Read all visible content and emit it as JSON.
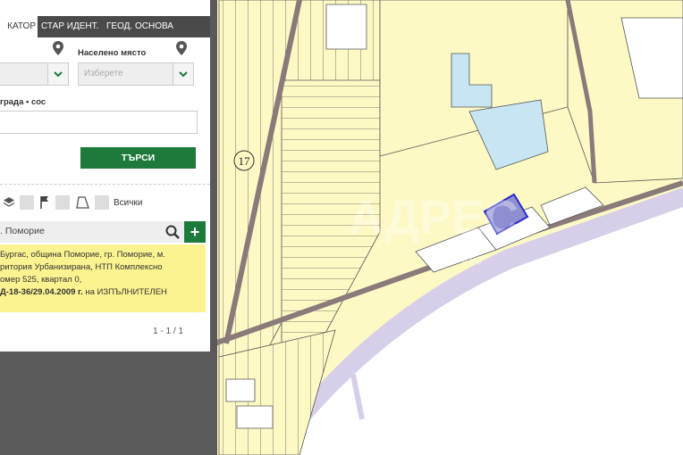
{
  "tabs": [
    {
      "label": "КАТОР"
    },
    {
      "label": "СТАР ИДЕНТ."
    },
    {
      "label": "ГЕОД. ОСНОВА"
    }
  ],
  "form": {
    "settlement_label": "Населено място",
    "settlement_placeholder": "Изберете",
    "building_label": "града • сос",
    "search_button": "ТЪРСИ"
  },
  "layers": {
    "all_label": "Всички"
  },
  "search_result": {
    "query": ". Поморие",
    "lines": [
      "Бургас, община Поморие, гр. Поморие, м.",
      "ритория Урбанизирана, НТП Комплексно",
      "омер 525, квартал 0,"
    ],
    "line4_bold": "Д-18-36/29.04.2009 г.",
    "line4_rest": " на ИЗПЪЛНИТЕЛЕН"
  },
  "pagination": "1 - 1 / 1",
  "map": {
    "label": "17",
    "watermark": "АДРЕС",
    "watermark_small": "ss.bg",
    "colors": {
      "parcel": "#fdf9c4",
      "road": "#8a7a7a",
      "water": "#c7e5f2",
      "sea": "#d7cfea",
      "selected": "#8d8fd2",
      "outline": "#2a2ac8"
    }
  }
}
